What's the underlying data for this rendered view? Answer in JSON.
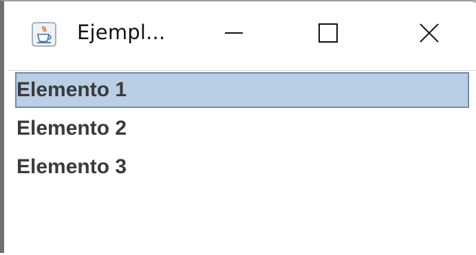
{
  "window": {
    "title": "Ejempl...",
    "app_icon": "java-coffee-cup-icon",
    "controls": {
      "minimize_icon": "minimize-icon",
      "maximize_icon": "maximize-icon",
      "close_icon": "close-icon"
    }
  },
  "list": {
    "items": [
      {
        "label": "Elemento 1",
        "selected": true
      },
      {
        "label": "Elemento 2",
        "selected": false
      },
      {
        "label": "Elemento 3",
        "selected": false
      }
    ]
  },
  "colors": {
    "selection_background": "#b8cfe5",
    "selection_border": "#6d8aa8",
    "item_text": "#3a3a3a"
  }
}
